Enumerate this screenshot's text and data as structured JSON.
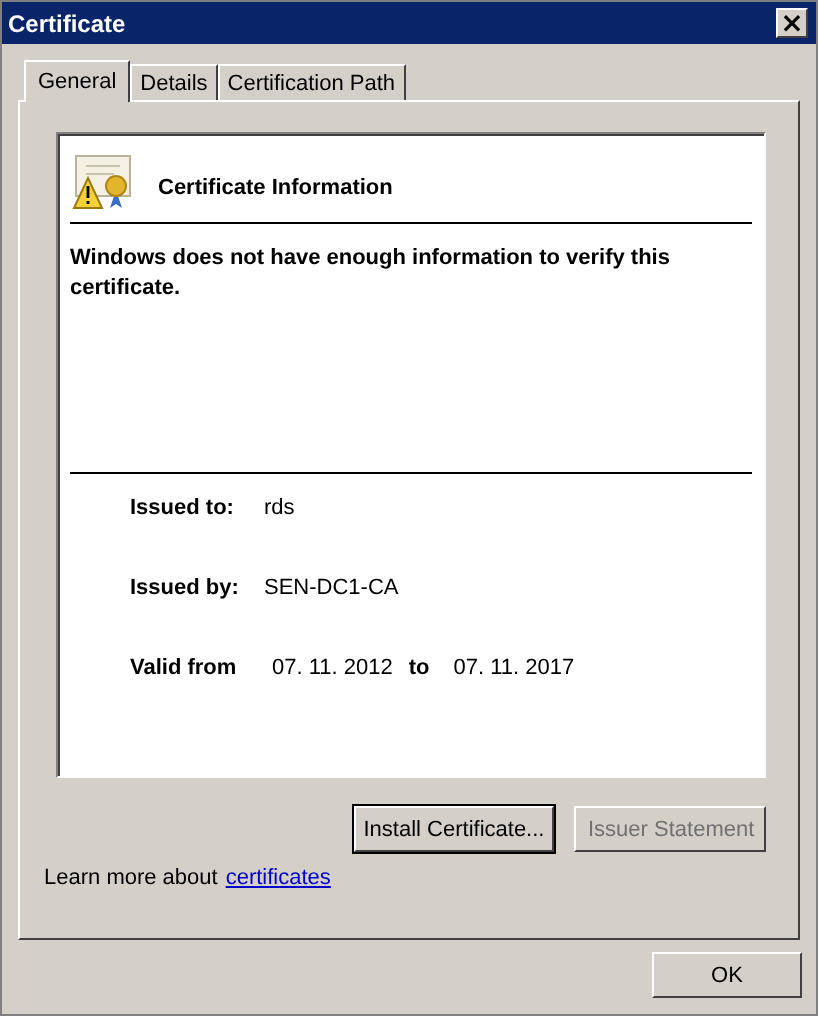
{
  "window": {
    "title": "Certificate",
    "close": "×"
  },
  "tabs": [
    {
      "label": "General",
      "selected": true
    },
    {
      "label": "Details",
      "selected": false
    },
    {
      "label": "Certification Path",
      "selected": false
    }
  ],
  "info": {
    "heading": "Certificate Information",
    "message": "Windows does not have enough information to verify this certificate.",
    "issued_to": {
      "label": "Issued to:",
      "value": "rds"
    },
    "issued_by": {
      "label": "Issued by:",
      "value": "SEN-DC1-CA"
    },
    "valid": {
      "label": "Valid from",
      "from": "07. 11. 2012",
      "joiner": "to",
      "to": "07. 11. 2017"
    }
  },
  "buttons": [
    {
      "label": "Install Certificate...",
      "disabled": false,
      "focused": true
    },
    {
      "label": "Issuer Statement",
      "disabled": true,
      "focused": false
    }
  ],
  "learn_more": {
    "text": "Learn more about",
    "link": "certificates"
  },
  "footer_buttons": [
    "OK"
  ]
}
